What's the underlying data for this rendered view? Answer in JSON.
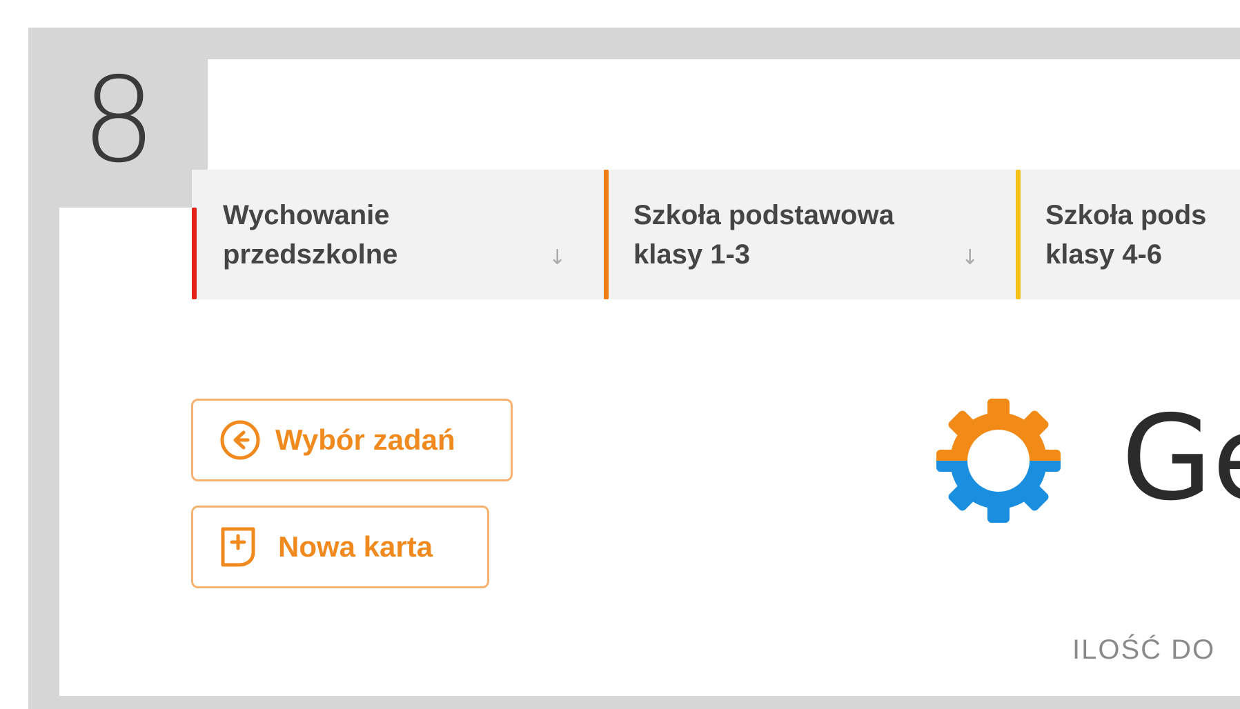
{
  "step": {
    "number": "8"
  },
  "tabs": [
    {
      "label": "Wychowanie\nprzedszkolne",
      "color": "#e32219",
      "arrow": "↓"
    },
    {
      "label": "Szkoła podstawowa\nklasy 1-3",
      "color": "#f07d12",
      "arrow": "↓"
    },
    {
      "label": "Szkoła pods\nklasy 4-6",
      "color": "#f5c116"
    }
  ],
  "buttons": {
    "task_select": {
      "label": "Wybór zadań",
      "icon": "arrow-left-circle-icon"
    },
    "new_card": {
      "label": "Nowa karta",
      "icon": "new-card-icon"
    }
  },
  "logo": {
    "text": "Ge",
    "icon": "gear-icon",
    "colors": {
      "top": "#f28a17",
      "bottom": "#1b8fdf"
    }
  },
  "count": {
    "label": "ILOŚĆ DO"
  },
  "colors": {
    "accent": "#f08a1f",
    "button_border": "#f7b272"
  }
}
